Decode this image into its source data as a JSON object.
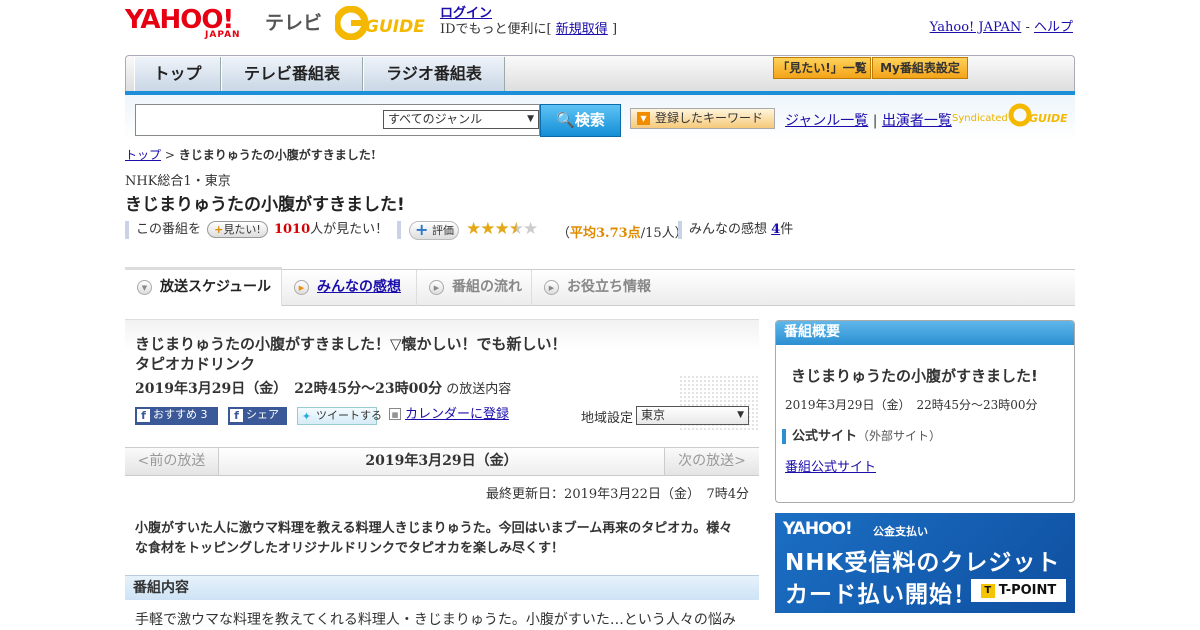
{
  "header": {
    "yahoo_logo": "YAHOO!",
    "japan_label": "JAPAN",
    "tv_label": "テレビ",
    "gguide_label": "G-GUIDE",
    "login": "ログイン",
    "login_sub": "IDでもっと便利に[",
    "register": "新規取得",
    "bracket_close": "]",
    "yahoo_japan_link": "Yahoo! JAPAN",
    "sep": "-",
    "help": "ヘルプ"
  },
  "nav": {
    "tabs": [
      "トップ",
      "テレビ番組表",
      "ラジオ番組表"
    ],
    "mitai_list": "「見たい!」一覧",
    "my_bangumi": "My番組表設定"
  },
  "search": {
    "genre_selected": "すべてのジャンル",
    "search_button": "検索",
    "keyword_button": "登録したキーワード",
    "genre_list": "ジャンル一覧",
    "divider": "|",
    "performer_list": "出演者一覧",
    "syndicated": "Syndicated"
  },
  "breadcrumb": {
    "top": "トップ",
    "sep": ">",
    "current": "きじまりゅうたの小腹がすきました!"
  },
  "program": {
    "channel": "NHK総合1・東京",
    "title": "きじまりゅうたの小腹がすきました!",
    "this_program": "この番組を",
    "mitai_button": "見たい!",
    "mitai_count": "1010",
    "mitai_suffix": "人が見たい！",
    "hyoka_button": "評価",
    "rating": 3.73,
    "avg_prefix": "（",
    "avg_label": "平均3.73点",
    "avg_count": "/15人）",
    "impressions_label": "みんなの感想",
    "impressions_count": "4",
    "impressions_suffix": "件"
  },
  "tabs": [
    {
      "label": "放送スケジュール"
    },
    {
      "label": "みんなの感想"
    },
    {
      "label": "番組の流れ"
    },
    {
      "label": "お役立ち情報"
    }
  ],
  "episode": {
    "title": "きじまりゅうたの小腹がすきました！▽懐かしい！でも新しい！タピオカドリンク",
    "datetime": "2019年3月29日（金）　22時45分～23時00分",
    "datetime_suffix": "の放送内容",
    "fb_recommend": "おすすめ 3",
    "fb_share": "シェア",
    "tweet": "ツイートする",
    "calendar": "カレンダーに登録",
    "region_label": "地域設定",
    "region_selected": "東京",
    "prev": "<前の放送",
    "date": "2019年3月29日（金）",
    "next": "次の放送>",
    "updated": "最終更新日：2019年3月22日（金）　7時4分",
    "summary": "小腹がすいた人に激ウマ料理を教える料理人きじまりゅうた。今回はいまブーム再来のタピオカ。様々な食材をトッピングしたオリジナルドリンクでタピオカを楽しみ尽くす！",
    "section_head": "番組内容",
    "body": "手軽で激ウマな料理を教えてくれる料理人・きじまりゅうた。小腹がすいた…という人々の悩み"
  },
  "overview": {
    "head": "番組概要",
    "title": "きじまりゅうたの小腹がすきました!",
    "datetime": "2019年3月29日（金）　22時45分～23時00分",
    "official_site": "公式サイト",
    "external": "（外部サイト）",
    "official_link": "番組公式サイト"
  },
  "ad": {
    "yahoo": "YAHOO!",
    "kokin": "公金支払い",
    "line1": "NHK受信料のクレジット",
    "line2": "カード払い開始！",
    "tpoint": "T-POINT"
  },
  "colors": {
    "brand_red": "#e60012",
    "nav_blue": "#1d8ed8",
    "accent_orange": "#e08a00",
    "link": "#1a0dab"
  }
}
